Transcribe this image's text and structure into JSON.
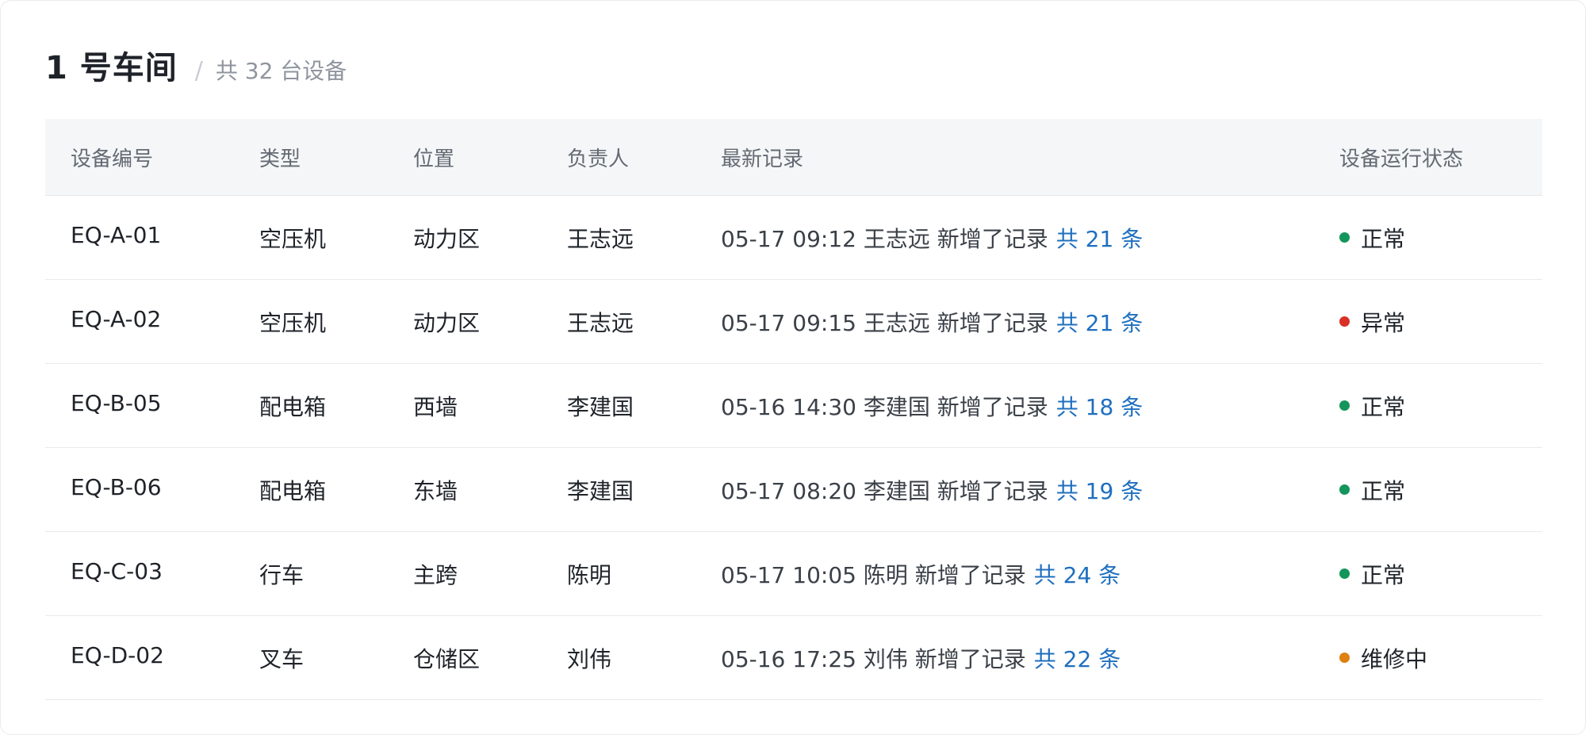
{
  "header": {
    "title": "1 号车间",
    "separator": "/",
    "subtitle": "共 32 台设备"
  },
  "columns": {
    "id": "设备编号",
    "type": "类型",
    "location": "位置",
    "owner": "负责人",
    "record": "最新记录",
    "status": "设备运行状态"
  },
  "status_colors": {
    "正常": "#13955b",
    "异常": "#d93026",
    "维修中": "#e0800f"
  },
  "rows": [
    {
      "id": "EQ-A-01",
      "type": "空压机",
      "location": "动力区",
      "owner": "王志远",
      "record": "05-17 09:12 王志远 新增了记录",
      "count": "共 21 条",
      "status": "正常",
      "status_color": "#13955b"
    },
    {
      "id": "EQ-A-02",
      "type": "空压机",
      "location": "动力区",
      "owner": "王志远",
      "record": "05-17 09:15 王志远 新增了记录",
      "count": "共 21 条",
      "status": "异常",
      "status_color": "#d93026"
    },
    {
      "id": "EQ-B-05",
      "type": "配电箱",
      "location": "西墙",
      "owner": "李建国",
      "record": "05-16 14:30 李建国 新增了记录",
      "count": "共 18 条",
      "status": "正常",
      "status_color": "#13955b"
    },
    {
      "id": "EQ-B-06",
      "type": "配电箱",
      "location": "东墙",
      "owner": "李建国",
      "record": "05-17 08:20 李建国 新增了记录",
      "count": "共 19 条",
      "status": "正常",
      "status_color": "#13955b"
    },
    {
      "id": "EQ-C-03",
      "type": "行车",
      "location": "主跨",
      "owner": "陈明",
      "record": "05-17 10:05 陈明 新增了记录",
      "count": "共 24 条",
      "status": "正常",
      "status_color": "#13955b"
    },
    {
      "id": "EQ-D-02",
      "type": "叉车",
      "location": "仓储区",
      "owner": "刘伟",
      "record": "05-16 17:25 刘伟 新增了记录",
      "count": "共 22 条",
      "status": "维修中",
      "status_color": "#e0800f"
    }
  ]
}
